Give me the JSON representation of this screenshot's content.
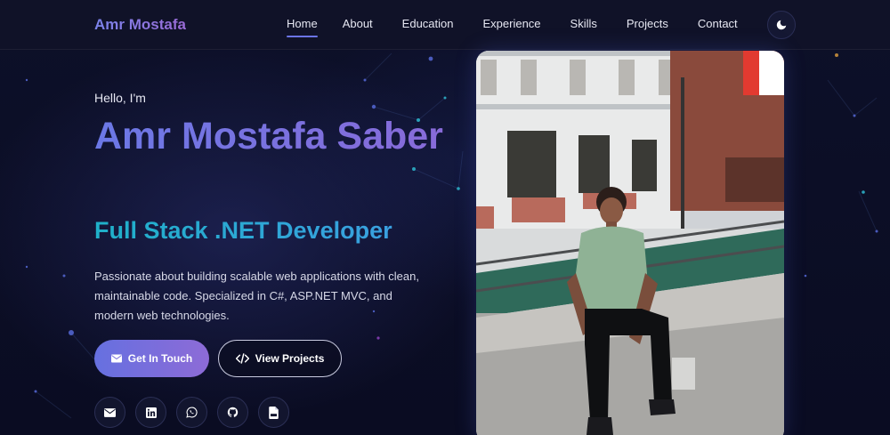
{
  "navbar": {
    "brand": "Amr Mostafa",
    "links": [
      {
        "label": "Home",
        "active": true
      },
      {
        "label": "About",
        "active": false
      },
      {
        "label": "Education",
        "active": false
      },
      {
        "label": "Experience",
        "active": false
      },
      {
        "label": "Skills",
        "active": false
      },
      {
        "label": "Projects",
        "active": false
      },
      {
        "label": "Contact",
        "active": false
      }
    ],
    "theme_toggle_icon": "moon-icon"
  },
  "hero": {
    "greeting": "Hello, I'm",
    "name": "Amr Mostafa Saber",
    "role": "Full Stack .NET Developer",
    "description": "Passionate about building scalable web applications with clean, maintainable code. Specialized in C#, ASP.NET MVC, and modern web technologies.",
    "primary_button": {
      "label": "Get In Touch",
      "icon": "envelope-icon"
    },
    "secondary_button": {
      "label": "View Projects",
      "icon": "code-icon"
    },
    "socials": [
      "envelope-icon",
      "linkedin-icon",
      "whatsapp-icon",
      "github-icon",
      "pdf-file-icon"
    ]
  },
  "profile_photo": {
    "subject": "profile-photo"
  },
  "colors": {
    "background": "#0b0d22",
    "accent": "#6b74e6",
    "accent_purple": "#8d6bd7",
    "role_cyan": "#1fb0c9"
  }
}
